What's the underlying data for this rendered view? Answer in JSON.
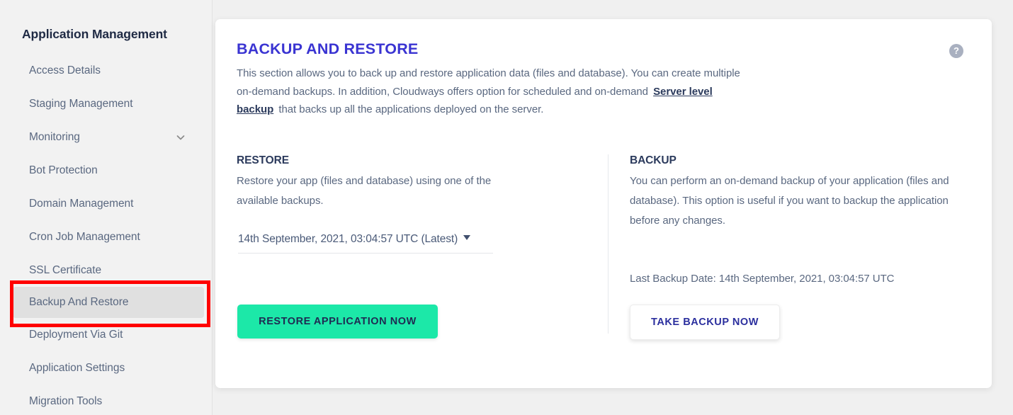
{
  "sidebar": {
    "title": "Application Management",
    "items": [
      {
        "label": "Access Details",
        "active": false,
        "icon": null
      },
      {
        "label": "Staging Management",
        "active": false,
        "icon": null
      },
      {
        "label": "Monitoring",
        "active": false,
        "icon": "chevron-down-icon"
      },
      {
        "label": "Bot Protection",
        "active": false,
        "icon": null
      },
      {
        "label": "Domain Management",
        "active": false,
        "icon": null
      },
      {
        "label": "Cron Job Management",
        "active": false,
        "icon": null
      },
      {
        "label": "SSL Certificate",
        "active": false,
        "icon": null
      },
      {
        "label": "Backup And Restore",
        "active": true,
        "icon": null
      },
      {
        "label": "Deployment Via Git",
        "active": false,
        "icon": null
      },
      {
        "label": "Application Settings",
        "active": false,
        "icon": null
      },
      {
        "label": "Migration Tools",
        "active": false,
        "icon": null
      }
    ]
  },
  "card": {
    "title": "BACKUP AND RESTORE",
    "help_icon": "help-circle-icon",
    "help_glyph": "?",
    "description_part1": "This section allows you to back up and restore application data (files and database). You can create multiple on-demand backups. In addition, Cloudways offers option for scheduled and on-demand ",
    "description_link": "Server level backup",
    "description_part2": " that backs up all the applications deployed on the server."
  },
  "restore": {
    "heading": "RESTORE",
    "description": "Restore your app (files and database) using one of the available backups.",
    "selected_backup": "14th September, 2021, 03:04:57 UTC (Latest)",
    "caret_icon": "caret-down-icon",
    "button_label": "RESTORE APPLICATION NOW"
  },
  "backup": {
    "heading": "BACKUP",
    "description": "You can perform an on-demand backup of your application (files and database). This option is useful if you want to backup the application before any changes.",
    "last_backup_label": "Last Backup Date: 14th September, 2021, 03:04:57 UTC",
    "button_label": "TAKE BACKUP NOW"
  },
  "colors": {
    "title_blue": "#3a34d2",
    "restore_green": "#1ce8a8",
    "backup_text_blue": "#2b2f9e",
    "body_text": "#5a6880",
    "heading_navy": "#2b3a5c",
    "annotation_red": "#ff0000"
  }
}
